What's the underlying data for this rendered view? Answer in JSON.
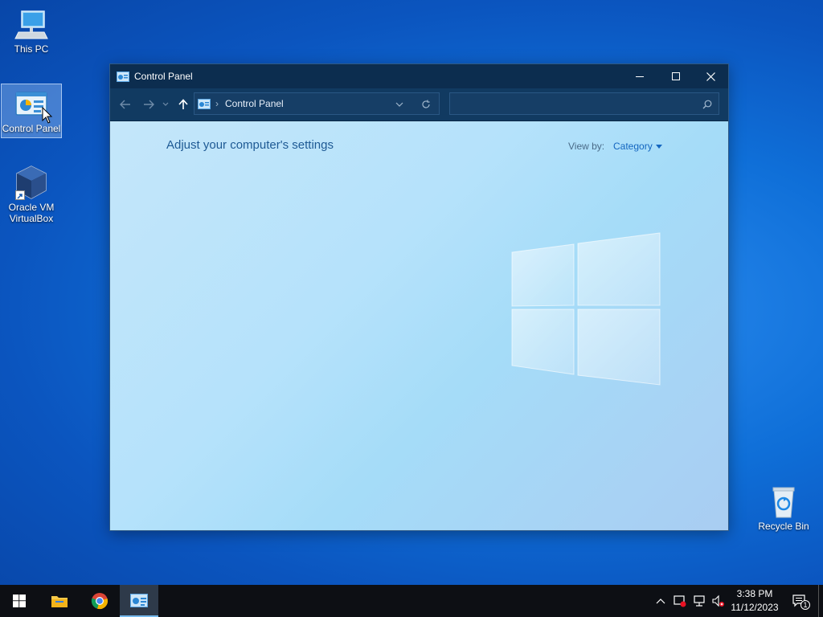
{
  "desktop": {
    "icons": [
      {
        "label": "This PC"
      },
      {
        "label": "Control Panel"
      },
      {
        "label_line1": "Oracle VM",
        "label_line2": "VirtualBox"
      },
      {
        "label": "Recycle Bin"
      }
    ]
  },
  "window": {
    "title": "Control Panel",
    "address": {
      "separator": "›",
      "path": "Control Panel"
    },
    "search": {
      "placeholder": ""
    },
    "heading": "Adjust your computer's settings",
    "view_by_label": "View by:",
    "view_by_value": "Category"
  },
  "taskbar": {
    "items": [
      "start-icon",
      "file-explorer-icon",
      "chrome-icon",
      "control-panel-icon"
    ],
    "active_item": "control-panel-icon",
    "clock": {
      "time": "3:38 PM",
      "date": "11/12/2023"
    },
    "notification_count": "1"
  },
  "colors": {
    "desktop_bg": "#0f6fd8",
    "titlebar": "#0c2d4f",
    "navbar": "#113a61",
    "heading_text": "#1e5a94",
    "link_text": "#1466c0",
    "taskbar": "#0d0f14"
  }
}
